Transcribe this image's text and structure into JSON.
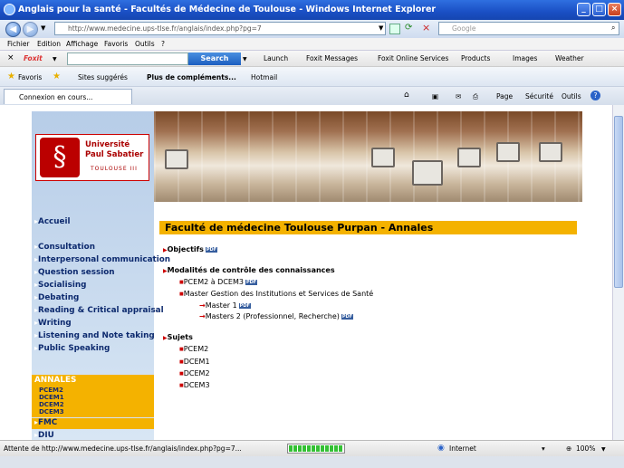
{
  "window": {
    "title": "Anglais pour la santé - Facultés de Médecine de Toulouse - Windows Internet Explorer"
  },
  "address": {
    "url": "http://www.medecine.ups-tlse.fr/anglais/index.php?pg=7",
    "search_placeholder": "Google"
  },
  "menu": [
    "Fichier",
    "Edition",
    "Affichage",
    "Favoris",
    "Outils",
    "?"
  ],
  "foxit": {
    "brand": "Foxit",
    "search": "Search",
    "items": [
      "Launch",
      "Foxit Messages",
      "Foxit Online Services",
      "Products",
      "Images",
      "Weather"
    ]
  },
  "favorites": {
    "label": "Favoris",
    "items": [
      "Sites suggérés",
      "Plus de compléments...",
      "Hotmail"
    ]
  },
  "tab": {
    "label": "Connexion en cours..."
  },
  "tools": [
    "Page",
    "Sécurité",
    "Outils"
  ],
  "logo": {
    "line1": "Université",
    "line2": "Paul Sabatier",
    "line3": "TOULOUSE III"
  },
  "sidebar": {
    "home": "Accueil",
    "items": [
      "Consultation",
      "Interpersonal communication",
      "Question session",
      "Socialising",
      "Debating",
      "Reading & Critical appraisal",
      "Writing",
      "Listening and Note taking",
      "Public Speaking"
    ],
    "annales": {
      "title": "ANNALES",
      "items": [
        "PCEM2",
        "DCEM1",
        "DCEM2",
        "DCEM3"
      ]
    },
    "fmc": "FMC",
    "diu": "DIU"
  },
  "content": {
    "heading": "Faculté de médecine Toulouse Purpan - Annales",
    "objectifs": "Objectifs",
    "modalites": "Modalités de contrôle des connaissances",
    "pcem2_dcem3": "PCEM2 à DCEM3",
    "master_title": "Master Gestion des Institutions et Services de Santé",
    "master1": "Master 1",
    "masters2": "Masters 2 (Professionnel, Recherche)",
    "sujets": "Sujets",
    "sujets_items": [
      "PCEM2",
      "DCEM1",
      "DCEM2",
      "DCEM3"
    ],
    "pdf_badge": "PDF"
  },
  "status": {
    "text": "Attente de http://www.medecine.ups-tlse.fr/anglais/index.php?pg=7...",
    "zone": "Internet",
    "zoom": "100%"
  }
}
